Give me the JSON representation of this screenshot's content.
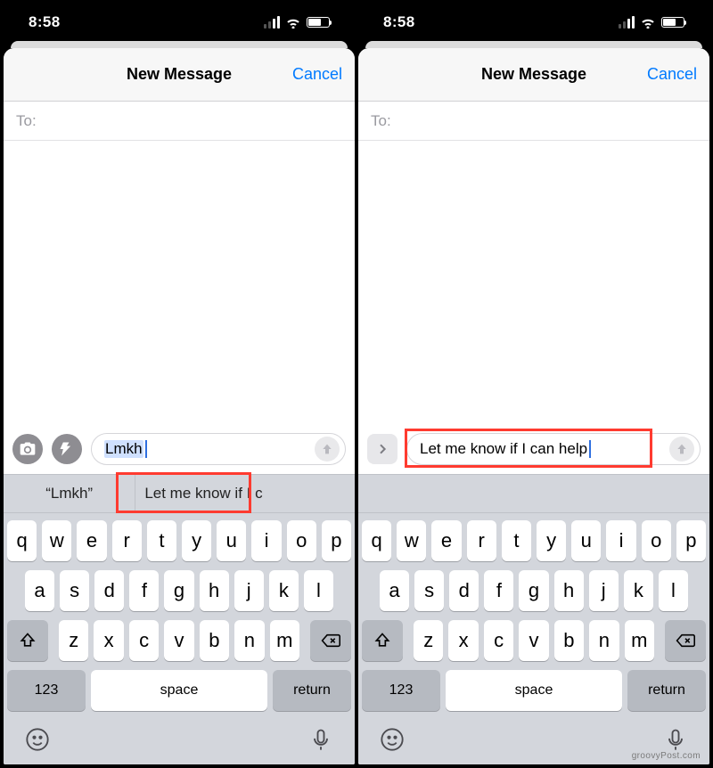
{
  "status_time": "8:58",
  "sheet": {
    "title": "New Message",
    "cancel": "Cancel",
    "to_label": "To:"
  },
  "left": {
    "apps_visible": true,
    "suggestions_visible": true,
    "msg_text": "Lmkh",
    "msg_selected": true,
    "suggestions": [
      "“Lmkh”",
      "Let me know if I c"
    ]
  },
  "right": {
    "apps_visible": false,
    "suggestions_visible": false,
    "msg_text": "Let me know if I can help",
    "msg_selected": false
  },
  "kb": {
    "row1": [
      "q",
      "w",
      "e",
      "r",
      "t",
      "y",
      "u",
      "i",
      "o",
      "p"
    ],
    "row2": [
      "a",
      "s",
      "d",
      "f",
      "g",
      "h",
      "j",
      "k",
      "l"
    ],
    "row3": [
      "z",
      "x",
      "c",
      "v",
      "b",
      "n",
      "m"
    ],
    "numbers": "123",
    "space": "space",
    "return": "return"
  },
  "watermark": "groovyPost.com"
}
